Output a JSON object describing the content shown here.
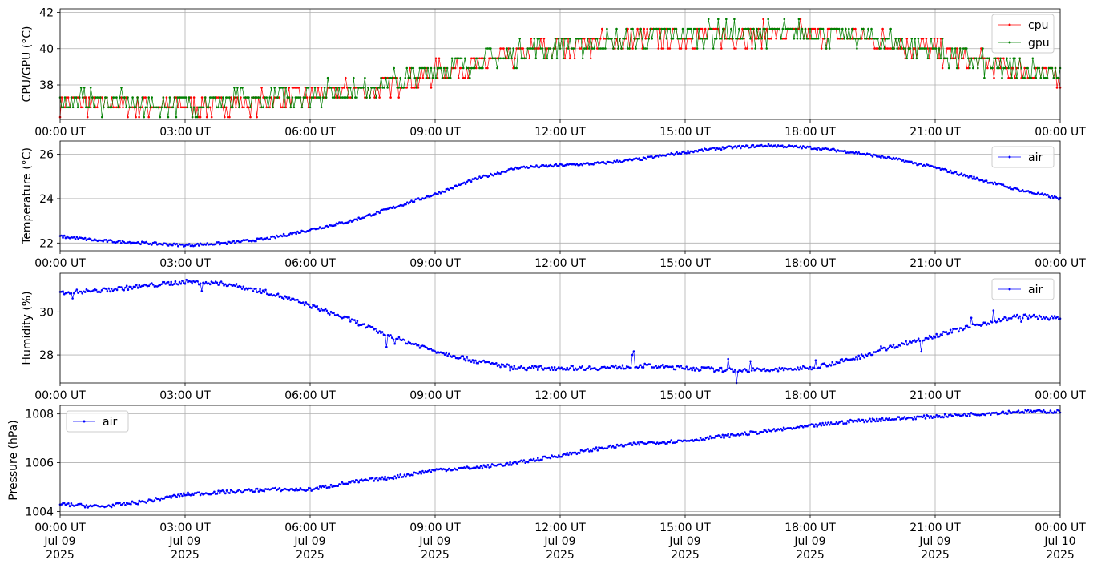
{
  "chart_data": [
    {
      "type": "line",
      "ylabel": "CPU/GPU (°C)",
      "ylim": [
        36.1,
        42.2
      ],
      "yticks": [
        38,
        40,
        42
      ],
      "grid": true,
      "legend_position": "top-right",
      "x_ticks": [
        "00:00 UT",
        "03:00 UT",
        "06:00 UT",
        "09:00 UT",
        "12:00 UT",
        "15:00 UT",
        "18:00 UT",
        "21:00 UT",
        "00:00 UT"
      ],
      "series": [
        {
          "name": "cpu",
          "color": "#ff0000",
          "x_hours": [
            0,
            1,
            2,
            3,
            4,
            5,
            6,
            7,
            8,
            9,
            10,
            11,
            12,
            13,
            14,
            15,
            16,
            17,
            18,
            19,
            20,
            21,
            22,
            23,
            24
          ],
          "values": [
            37.0,
            36.9,
            36.8,
            36.8,
            36.9,
            37.0,
            37.3,
            37.6,
            38.0,
            38.6,
            39.1,
            39.6,
            40.1,
            40.3,
            40.5,
            40.6,
            40.7,
            40.8,
            40.8,
            40.6,
            40.3,
            39.8,
            39.2,
            38.8,
            38.5
          ]
        },
        {
          "name": "gpu",
          "color": "#008000",
          "x_hours": [
            0,
            1,
            2,
            3,
            4,
            5,
            6,
            7,
            8,
            9,
            10,
            11,
            12,
            13,
            14,
            15,
            16,
            17,
            18,
            19,
            20,
            21,
            22,
            23,
            24
          ],
          "values": [
            37.1,
            37.0,
            36.9,
            36.9,
            37.0,
            37.1,
            37.4,
            37.7,
            38.1,
            38.7,
            39.2,
            39.7,
            40.1,
            40.3,
            40.5,
            40.7,
            40.8,
            40.8,
            40.8,
            40.7,
            40.3,
            39.8,
            39.2,
            38.8,
            38.6
          ]
        }
      ]
    },
    {
      "type": "line",
      "ylabel": "Temperature (°C)",
      "ylim": [
        21.65,
        26.6
      ],
      "yticks": [
        22,
        24,
        26
      ],
      "grid": true,
      "legend_position": "top-right",
      "x_ticks": [
        "00:00 UT",
        "03:00 UT",
        "06:00 UT",
        "09:00 UT",
        "12:00 UT",
        "15:00 UT",
        "18:00 UT",
        "21:00 UT",
        "00:00 UT"
      ],
      "series": [
        {
          "name": "air",
          "color": "#0000ff",
          "x_hours": [
            0,
            1,
            2,
            3,
            4,
            5,
            6,
            7,
            8,
            9,
            10,
            11,
            12,
            13,
            14,
            15,
            16,
            17,
            18,
            19,
            20,
            21,
            22,
            23,
            24
          ],
          "values": [
            22.3,
            22.1,
            22.0,
            21.9,
            22.0,
            22.2,
            22.6,
            23.0,
            23.6,
            24.2,
            24.9,
            25.4,
            25.5,
            25.6,
            25.8,
            26.1,
            26.3,
            26.4,
            26.3,
            26.1,
            25.8,
            25.4,
            24.9,
            24.4,
            24.0
          ]
        }
      ]
    },
    {
      "type": "line",
      "ylabel": "Humidity (%)",
      "ylim": [
        26.7,
        31.8
      ],
      "yticks": [
        28,
        30
      ],
      "grid": true,
      "legend_position": "top-right",
      "x_ticks": [
        "00:00 UT",
        "03:00 UT",
        "06:00 UT",
        "09:00 UT",
        "12:00 UT",
        "15:00 UT",
        "18:00 UT",
        "21:00 UT",
        "00:00 UT"
      ],
      "series": [
        {
          "name": "air",
          "color": "#0000ff",
          "x_hours": [
            0,
            1,
            2,
            3,
            4,
            5,
            6,
            7,
            8,
            9,
            10,
            11,
            12,
            13,
            14,
            15,
            16,
            17,
            18,
            19,
            20,
            21,
            22,
            23,
            24
          ],
          "values": [
            30.9,
            31.0,
            31.2,
            31.4,
            31.3,
            30.9,
            30.3,
            29.6,
            28.8,
            28.2,
            27.7,
            27.4,
            27.4,
            27.4,
            27.5,
            27.4,
            27.3,
            27.3,
            27.4,
            27.8,
            28.4,
            28.9,
            29.4,
            29.8,
            29.7
          ]
        }
      ]
    },
    {
      "type": "line",
      "ylabel": "Pressure (hPa)",
      "ylim": [
        1003.85,
        1008.35
      ],
      "yticks": [
        1004,
        1006,
        1008
      ],
      "grid": true,
      "legend_position": "top-left",
      "x_ticks": [
        "00:00 UT\nJul 09\n2025",
        "03:00 UT\nJul 09\n2025",
        "06:00 UT\nJul 09\n2025",
        "09:00 UT\nJul 09\n2025",
        "12:00 UT\nJul 09\n2025",
        "15:00 UT\nJul 09\n2025",
        "18:00 UT\nJul 09\n2025",
        "21:00 UT\nJul 09\n2025",
        "00:00 UT\nJul 10\n2025"
      ],
      "series": [
        {
          "name": "air",
          "color": "#0000ff",
          "x_hours": [
            0,
            1,
            2,
            3,
            4,
            5,
            6,
            7,
            8,
            9,
            10,
            11,
            12,
            13,
            14,
            15,
            16,
            17,
            18,
            19,
            20,
            21,
            22,
            23,
            24
          ],
          "values": [
            1004.3,
            1004.2,
            1004.4,
            1004.7,
            1004.8,
            1004.9,
            1004.9,
            1005.2,
            1005.4,
            1005.7,
            1005.8,
            1006.0,
            1006.3,
            1006.6,
            1006.8,
            1006.9,
            1007.1,
            1007.3,
            1007.5,
            1007.7,
            1007.8,
            1007.9,
            1008.0,
            1008.1,
            1008.1
          ]
        }
      ]
    }
  ]
}
